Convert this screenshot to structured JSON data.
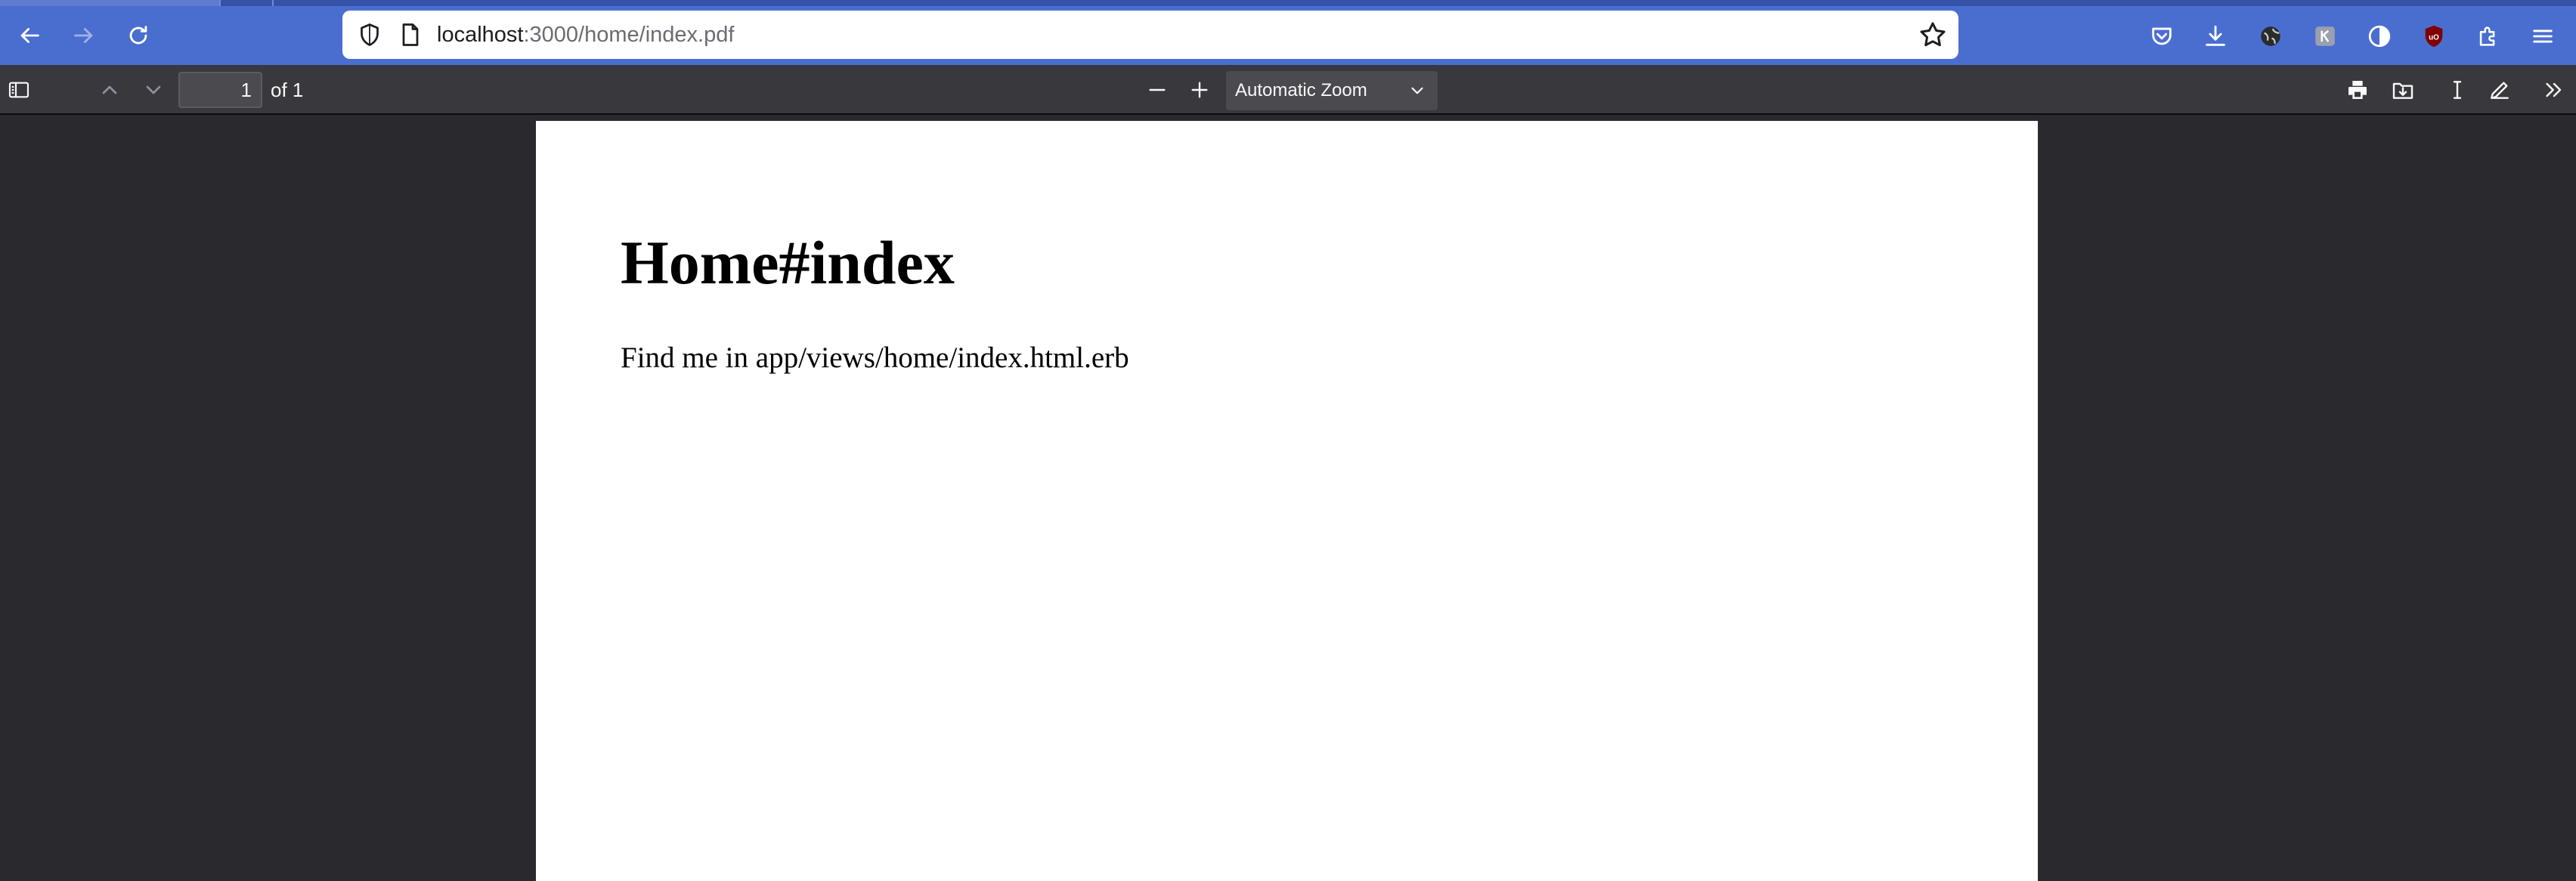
{
  "browser": {
    "url_host": "localhost",
    "url_rest": ":3000/home/index.pdf",
    "icons": {
      "back": "back-arrow-icon",
      "forward": "forward-arrow-icon",
      "reload": "reload-icon",
      "shield": "tracking-protection-shield-icon",
      "page": "page-document-icon",
      "bookmark": "bookmark-star-icon",
      "pocket": "pocket-icon",
      "downloads": "download-icon",
      "extensions": "puzzle-extensions-icon",
      "menu": "hamburger-menu-icon"
    }
  },
  "pdf_toolbar": {
    "page_number": "1",
    "page_count": "of 1",
    "zoom": "Automatic Zoom"
  },
  "document": {
    "heading": "Home#index",
    "body": "Find me in app/views/home/index.html.erb"
  },
  "colors": {
    "chrome_accent": "#4a6ed0",
    "pdf_toolbar": "#38383d",
    "viewer_bg": "#2a2a2e"
  }
}
